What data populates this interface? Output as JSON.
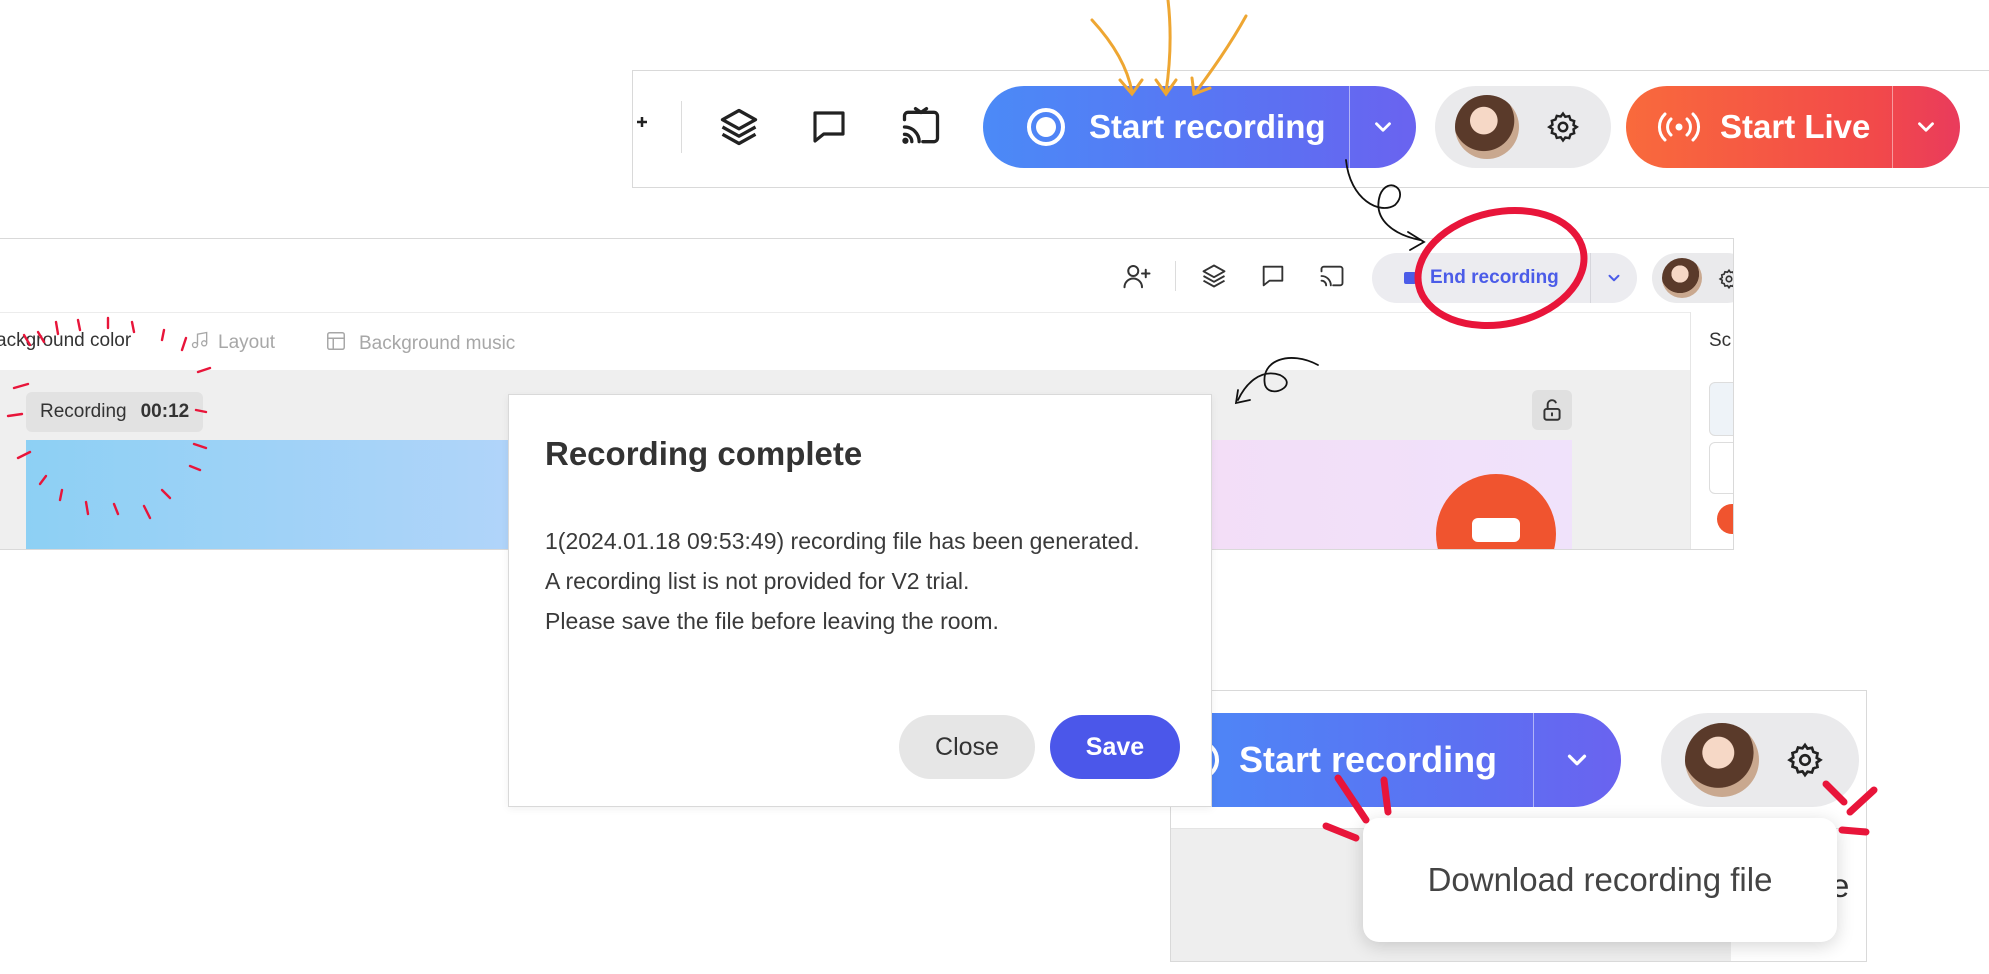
{
  "toolbar_top": {
    "start_recording_label": "Start recording",
    "start_live_label": "Start Live",
    "icons": [
      "participant-icon",
      "layers-icon",
      "chat-icon",
      "cast-icon",
      "record-icon",
      "chevron-down-icon",
      "settings-icon",
      "broadcast-icon"
    ]
  },
  "studio": {
    "end_recording_label": "End recording",
    "tabs": [
      {
        "label": "ackground color",
        "active": true
      },
      {
        "label": "Layout",
        "active": false
      },
      {
        "label": "Background music",
        "active": false
      }
    ],
    "recording_label": "Recording",
    "recording_time": "00:12",
    "side_label": "Sc"
  },
  "dialog": {
    "title": "Recording complete",
    "lines": [
      "1(2024.01.18 09:53:49) recording file has been generated.",
      "A recording list is not provided for V2 trial.",
      "Please save the file before leaving the room."
    ],
    "close_label": "Close",
    "save_label": "Save"
  },
  "dropdown_panel": {
    "start_recording_label": "Start recording",
    "menu_item": "Download recording file",
    "partial_text": "e"
  },
  "colors": {
    "record_blue_start": "#4b8af7",
    "record_blue_end": "#6a63f0",
    "live_orange": "#f96a3c",
    "live_red": "#e93b5c",
    "save_button": "#4b57ea",
    "annotation_red": "#e8153a",
    "annotation_orange": "#eea632"
  }
}
